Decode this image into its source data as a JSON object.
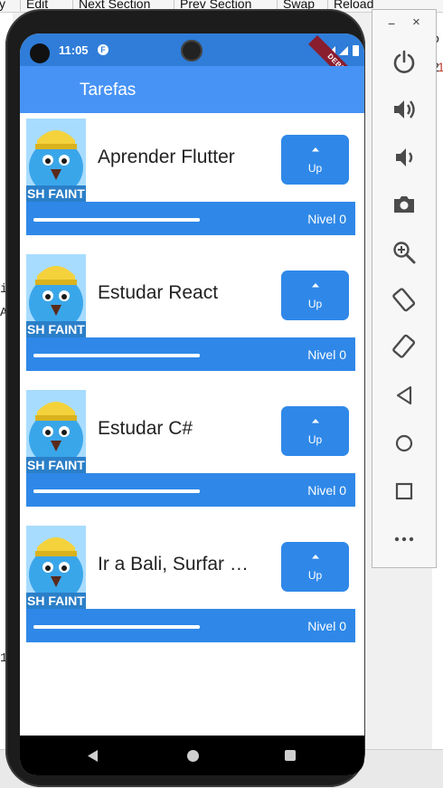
{
  "ide": {
    "menu": [
      "y",
      "Edit",
      "Next Section",
      "Prev Section",
      "Swap",
      "Reload"
    ],
    "left_gutter": [
      "i",
      "A",
      "1"
    ],
    "right_gutter": [
      "o",
      "2",
      "1"
    ]
  },
  "status_bar": {
    "time": "11:05",
    "app_badge": "F",
    "debug_label": "DEBUG"
  },
  "app_bar": {
    "title": "Tarefas"
  },
  "tasks": [
    {
      "name": "Aprender Flutter",
      "button_label": "Up",
      "level_label": "Nivel 0",
      "progress": 1.0,
      "image_caption": "SH FAINT"
    },
    {
      "name": "Estudar React",
      "button_label": "Up",
      "level_label": "Nivel 0",
      "progress": 1.0,
      "image_caption": "SH FAINT"
    },
    {
      "name": "Estudar C#",
      "button_label": "Up",
      "level_label": "Nivel 0",
      "progress": 1.0,
      "image_caption": "SH FAINT"
    },
    {
      "name": "Ir a Bali, Surfar …",
      "button_label": "Up",
      "level_label": "Nivel 0",
      "progress": 1.0,
      "image_caption": "SH FAINT"
    }
  ],
  "emulator": {
    "minimize_label": "−",
    "close_label": "×",
    "controls": [
      "power-icon",
      "volume-up-icon",
      "volume-down-icon",
      "camera-icon",
      "zoom-icon",
      "rotate-left-icon",
      "rotate-right-icon",
      "back-icon",
      "home-icon",
      "overview-icon",
      "more-icon"
    ]
  },
  "colors": {
    "status_bar": "#2f7dd9",
    "app_bar": "#4793f5",
    "card_accent": "#2f88e8"
  }
}
